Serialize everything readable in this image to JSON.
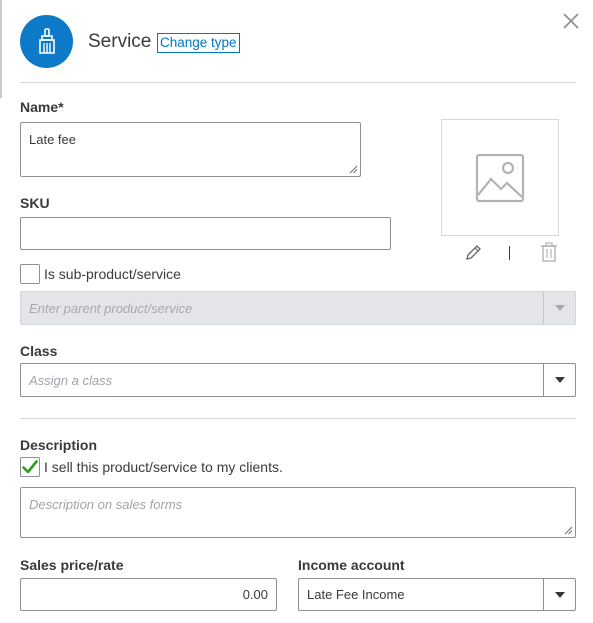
{
  "header": {
    "title": "Service",
    "change_type_label": "Change type",
    "avatar_icon": "paint-brush-icon",
    "accent_color": "#0d79c9"
  },
  "form": {
    "name": {
      "label": "Name*",
      "value": "Late fee"
    },
    "sku": {
      "label": "SKU",
      "value": ""
    },
    "sub_product": {
      "checkbox_label": "Is sub-product/service",
      "checked": false,
      "parent_placeholder": "Enter parent product/service"
    },
    "class": {
      "label": "Class",
      "placeholder": "Assign a class"
    },
    "description": {
      "label": "Description",
      "sell_checkbox_label": "I sell this product/service to my clients.",
      "sell_checked": true,
      "placeholder": "Description on sales forms"
    },
    "sales_price": {
      "label": "Sales price/rate",
      "value": "0.00"
    },
    "income_account": {
      "label": "Income account",
      "value": "Late Fee Income"
    }
  },
  "image_panel": {
    "icons": [
      "image-placeholder-icon",
      "pencil-icon",
      "trash-icon"
    ]
  },
  "colors": {
    "check_green": "#2ca01c",
    "link_blue": "#0077c5"
  }
}
